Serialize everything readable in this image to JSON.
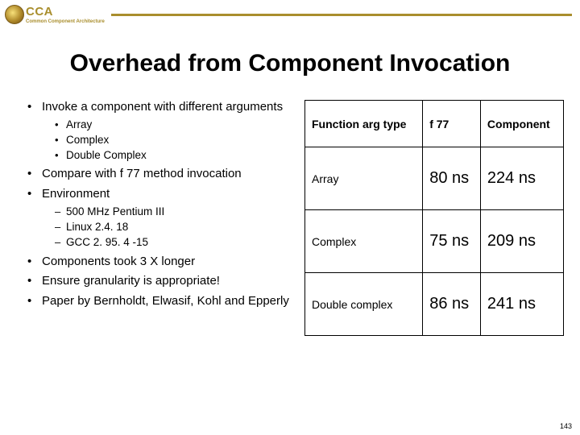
{
  "header": {
    "acronym": "CCA",
    "full": "Common Component Architecture"
  },
  "title": "Overhead from Component Invocation",
  "bullets": {
    "b1": "Invoke a component with different arguments",
    "b1_sub": [
      "Array",
      "Complex",
      "Double Complex"
    ],
    "b2": "Compare with f 77 method invocation",
    "b3": "Environment",
    "b3_sub": [
      "500 MHz Pentium III",
      "Linux 2.4. 18",
      "GCC 2. 95. 4 -15"
    ],
    "b4": "Components took 3 X longer",
    "b5": "Ensure granularity is appropriate!",
    "b6": "Paper by Bernholdt, Elwasif, Kohl and Epperly"
  },
  "table": {
    "head": [
      "Function arg type",
      "f 77",
      "Component"
    ],
    "rows": [
      {
        "label": "Array",
        "f77": "80 ns",
        "comp": "224 ns"
      },
      {
        "label": "Complex",
        "f77": "75 ns",
        "comp": "209 ns"
      },
      {
        "label": "Double complex",
        "f77": "86 ns",
        "comp": "241 ns"
      }
    ]
  },
  "page_number": "143",
  "chart_data": {
    "type": "table",
    "title": "Overhead from Component Invocation",
    "columns": [
      "Function arg type",
      "f 77",
      "Component"
    ],
    "rows": [
      [
        "Array",
        "80 ns",
        "224 ns"
      ],
      [
        "Complex",
        "75 ns",
        "209 ns"
      ],
      [
        "Double complex",
        "86 ns",
        "241 ns"
      ]
    ]
  }
}
